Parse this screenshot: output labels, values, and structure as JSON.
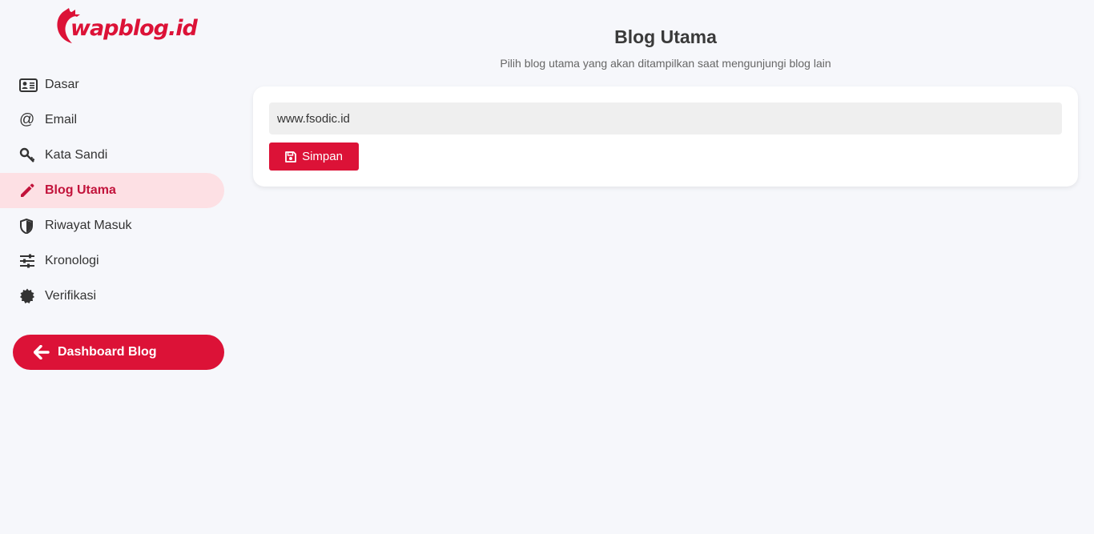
{
  "brand": {
    "logo_text": "wapblog.id",
    "accent_color": "#dc1237"
  },
  "sidebar": {
    "items": [
      {
        "label": "Dasar",
        "icon": "id-card-icon"
      },
      {
        "label": "Email",
        "icon": "at-icon"
      },
      {
        "label": "Kata Sandi",
        "icon": "key-icon"
      },
      {
        "label": "Blog Utama",
        "icon": "pencil-icon",
        "active": true
      },
      {
        "label": "Riwayat Masuk",
        "icon": "shield-icon"
      },
      {
        "label": "Kronologi",
        "icon": "sliders-icon"
      },
      {
        "label": "Verifikasi",
        "icon": "badge-icon"
      }
    ],
    "dashboard_button": {
      "label": "Dashboard Blog",
      "icon": "arrow-left-icon"
    }
  },
  "main": {
    "title": "Blog Utama",
    "subtitle": "Pilih blog utama yang akan ditampilkan saat mengunjungi blog lain",
    "blog_select": {
      "value": "www.fsodic.id"
    },
    "save_button": {
      "label": "Simpan",
      "icon": "floppy-disk-icon"
    }
  }
}
